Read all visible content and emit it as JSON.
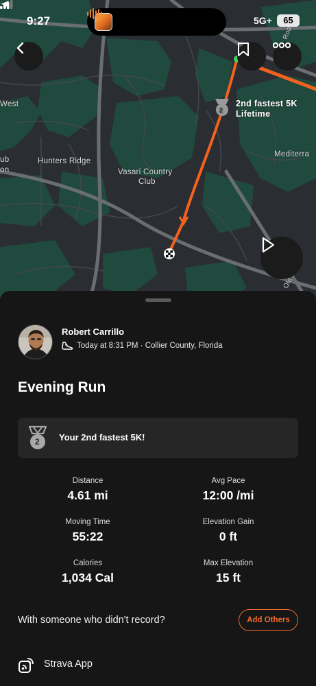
{
  "status_bar": {
    "time": "9:27",
    "network": "5G+",
    "battery": "65"
  },
  "map": {
    "labels": {
      "west": "West",
      "ub": "ub",
      "on": "on",
      "hunters_ridge": "Hunters Ridge",
      "vasari_line1": "Vasari Country",
      "vasari_line2": "Club",
      "mediterra": "Mediterra",
      "road_top": "Road",
      "road_bottom": "Old Road"
    },
    "segment_badge": {
      "number": "2",
      "line1": "2nd fastest 5K",
      "line2": "Lifetime"
    }
  },
  "colors": {
    "accent": "#f26a2d",
    "route": "#f4621f",
    "map_green": "#1f4a3d",
    "map_base": "#2a2d31",
    "sheet_bg": "#161616",
    "card_bg": "#262626"
  },
  "activity": {
    "athlete_name": "Robert Carrillo",
    "meta": "Today at 8:31 PM · Collier County, Florida",
    "title": "Evening Run",
    "achievement": {
      "medal_number": "2",
      "text": "Your 2nd fastest 5K!"
    },
    "stats": {
      "distance": {
        "label": "Distance",
        "value": "4.61 mi"
      },
      "avg_pace": {
        "label": "Avg Pace",
        "value": "12:00 /mi"
      },
      "moving_time": {
        "label": "Moving Time",
        "value": "55:22"
      },
      "elevation_gain": {
        "label": "Elevation Gain",
        "value": "0 ft"
      },
      "calories": {
        "label": "Calories",
        "value": "1,034 Cal"
      },
      "max_elevation": {
        "label": "Max Elevation",
        "value": "15 ft"
      }
    },
    "with_someone": "With someone who didn't record?",
    "add_others": "Add Others",
    "strava_app": "Strava App"
  },
  "icons": {
    "back": "chevron-left-icon",
    "bookmark": "bookmark-icon",
    "more": "more-icon",
    "play": "play-icon",
    "shoe": "shoe-icon",
    "medal": "medal-icon",
    "app": "strava-app-icon"
  }
}
